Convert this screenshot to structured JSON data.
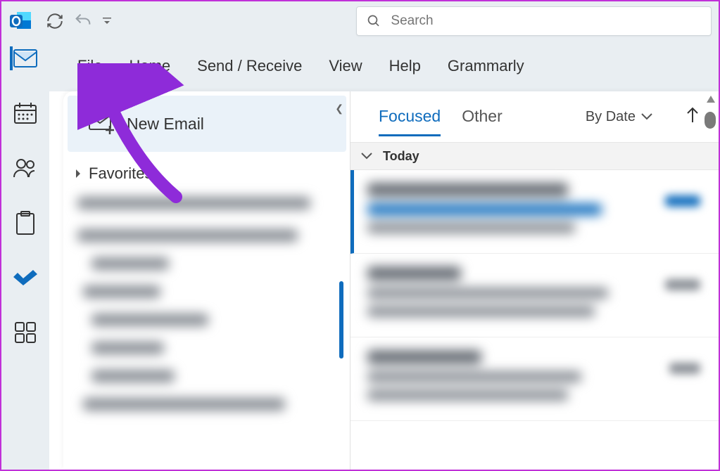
{
  "topbar": {
    "search_placeholder": "Search"
  },
  "ribbon": {
    "file": "File",
    "home": "Home",
    "sendreceive": "Send / Receive",
    "view": "View",
    "help": "Help",
    "grammarly": "Grammarly"
  },
  "folderpane": {
    "new_email": "New Email",
    "favorites": "Favorites"
  },
  "msgpane": {
    "tab_focused": "Focused",
    "tab_other": "Other",
    "sort_label": "By Date",
    "group_today": "Today"
  }
}
